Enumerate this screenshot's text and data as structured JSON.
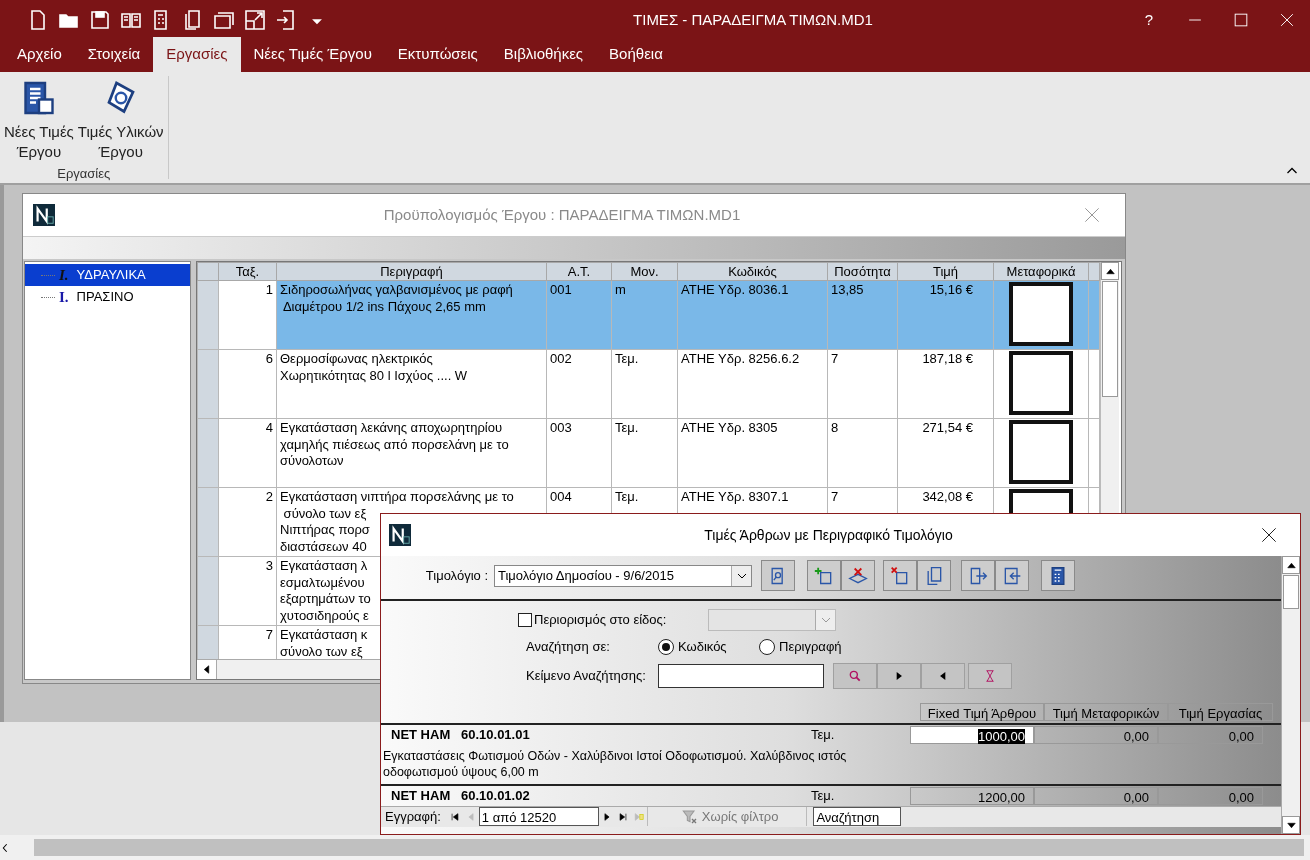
{
  "window": {
    "title": "ΤΙΜΕΣ - ΠΑΡΑΔΕΙΓΜΑ ΤΙΜΩΝ.MD1",
    "help": "?"
  },
  "menu_tabs": [
    {
      "label": "Αρχείο",
      "selected": false
    },
    {
      "label": "Στοιχεία",
      "selected": false
    },
    {
      "label": "Εργασίες",
      "selected": true
    },
    {
      "label": "Νέες Τιμές Έργου",
      "selected": false
    },
    {
      "label": "Εκτυπώσεις",
      "selected": false
    },
    {
      "label": "Βιβλιοθήκες",
      "selected": false
    },
    {
      "label": "Βοήθεια",
      "selected": false
    }
  ],
  "ribbon": {
    "buttons": [
      {
        "label": "Νέες Τιμές\nΈργου",
        "kind": "document"
      },
      {
        "label": "Τιμές Υλικών\nΈργου",
        "kind": "tags"
      }
    ],
    "group_label": "Εργασίες"
  },
  "budget_window": {
    "title": "Προϋπολογισμός Έργου :  ΠΑΡΑΔΕΙΓΜΑ ΤΙΜΩΝ.MD1",
    "tree": [
      {
        "icon": "I.",
        "label": "ΥΔΡΑΥΛΙΚΑ",
        "selected": true
      },
      {
        "icon": "I.",
        "label": "ΠΡΑΣΙΝΟ",
        "selected": false
      }
    ],
    "table": {
      "columns": [
        "Ταξ.",
        "Περιγραφή",
        "Α.Τ.",
        "Μον.",
        "Κωδικός",
        "Ποσότητα",
        "Τιμή",
        "Μεταφορικά"
      ],
      "rows": [
        {
          "order": "1",
          "description": "Σιδηροσωλήνας γαλβανισμένος με ραφή\n Διαμέτρου 1/2 ins Πάχους 2,65 mm",
          "item_no": "001",
          "unit": "m",
          "code": "ΑΤΗΕ Υδρ. 8036.1",
          "quantity": "13,85",
          "price": "15,16 €",
          "transport": false,
          "selected": true
        },
        {
          "order": "6",
          "description": "Θερμοσίφωνας ηλεκτρικός\nΧωρητικότητας 80 l Ισχύος .... W",
          "item_no": "002",
          "unit": "Τεμ.",
          "code": "ΑΤΗΕ Υδρ. 8256.6.2",
          "quantity": "7",
          "price": "187,18 €",
          "transport": false,
          "selected": false
        },
        {
          "order": "4",
          "description": "Εγκατάσταση λεκάνης αποχωρητηρίου\nχαμηλής πιέσεως από πορσελάνη με το\nσύνολοτων",
          "item_no": "003",
          "unit": "Τεμ.",
          "code": "ΑΤΗΕ Υδρ. 8305",
          "quantity": "8",
          "price": "271,54 €",
          "transport": false,
          "selected": false
        },
        {
          "order": "2",
          "description": "Εγκατάσταση νιπτήρα πορσελάνης με το\n σύνολο των εξ\nΝιπτήρας πορσ\nδιαστάσεων 40",
          "item_no": "004",
          "unit": "Τεμ.",
          "code": "ΑΤΗΕ Υδρ. 8307.1",
          "quantity": "7",
          "price": "342,08 €",
          "transport": false,
          "selected": false
        },
        {
          "order": "3",
          "description": "Εγκατάσταση λ\nεσμαλτωμένου\nεξαρτημάτων το\nχυτοσιδηρούς ε",
          "selected": false
        },
        {
          "order": "7",
          "description": "Εγκατάσταση κ\nσύνολο των εξ",
          "selected": false
        }
      ]
    }
  },
  "price_dialog": {
    "title": "Τιμές Άρθρων με Περιγραφικό Τιμολόγιο",
    "pricelist_label": "Τιμολόγιο :",
    "pricelist": "Τιμολόγιο Δημοσίου - 9/6/2015",
    "restrict": {
      "label": "Περιορισμός στο είδος:",
      "checked": false
    },
    "search_in_label": "Αναζήτηση σε:",
    "search_in": [
      {
        "label": "Κωδικός",
        "selected": true
      },
      {
        "label": "Περιγραφή",
        "selected": false
      }
    ],
    "search_text_label": "Κείμενο Αναζήτησης:",
    "columns": [
      "Fixed Τιμή Άρθρου",
      "Τιμή Μεταφορικών",
      "Τιμή Εργασίας"
    ],
    "records": [
      {
        "prefix": "NET HAM",
        "code": "60.10.01.01",
        "unit": "Τεμ.",
        "fixed_price": "1000,00",
        "transport_price": "0,00",
        "labor_price": "0,00",
        "description": "Εγκαταστάσεις Φωτισμού Οδών - Χαλύβδινοι Ιστοί Οδοφωτισμού. Χαλύβδινος ιστός\nοδοφωτισμού ύψους 6,00 m",
        "editing": true
      },
      {
        "prefix": "NET HAM",
        "code": "60.10.01.02",
        "unit": "Τεμ.",
        "fixed_price": "1200,00",
        "transport_price": "0,00",
        "labor_price": "0,00",
        "editing": false
      }
    ],
    "navigator": {
      "label": "Εγγραφή:",
      "position": "1 από 12520",
      "filter": "Χωρίς φίλτρο",
      "search": "Αναζήτηση"
    }
  }
}
